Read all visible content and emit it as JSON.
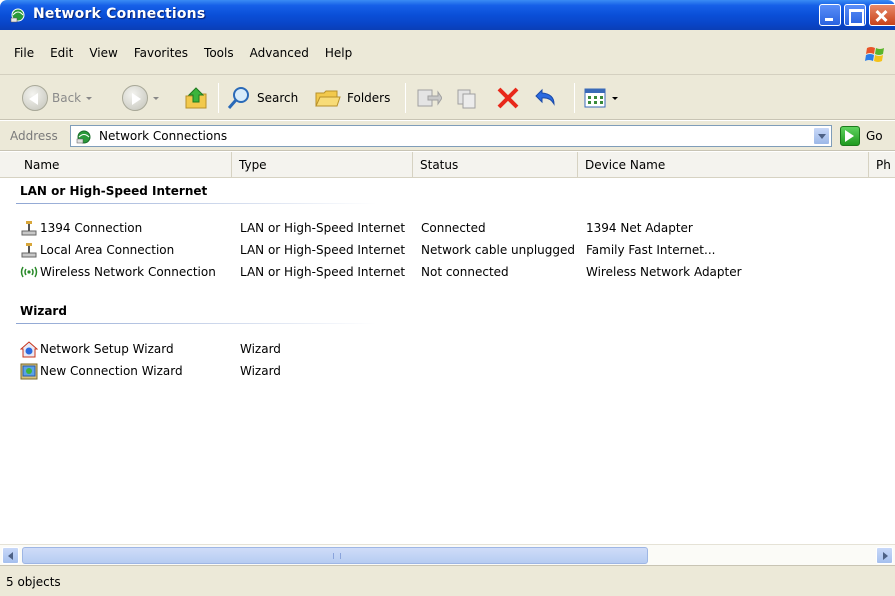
{
  "window": {
    "title": "Network Connections"
  },
  "menu": [
    "File",
    "Edit",
    "View",
    "Favorites",
    "Tools",
    "Advanced",
    "Help"
  ],
  "toolbar": {
    "back_label": "Back",
    "search_label": "Search",
    "folders_label": "Folders"
  },
  "address": {
    "label": "Address",
    "value": "Network Connections",
    "go_label": "Go"
  },
  "columns": [
    "Name",
    "Type",
    "Status",
    "Device Name",
    "Ph"
  ],
  "groups": [
    {
      "title": "LAN or High-Speed Internet",
      "items": [
        {
          "icon": "lan-connection-icon",
          "name": "1394 Connection",
          "type": "LAN or High-Speed Internet",
          "status": "Connected",
          "device": "1394 Net Adapter"
        },
        {
          "icon": "lan-connection-icon",
          "name": "Local Area Connection",
          "type": "LAN or High-Speed Internet",
          "status": "Network cable unplugged",
          "device": "Family Fast Internet..."
        },
        {
          "icon": "wireless-connection-icon",
          "name": "Wireless Network Connection",
          "type": "LAN or High-Speed Internet",
          "status": "Not connected",
          "device": "Wireless Network Adapter"
        }
      ]
    },
    {
      "title": "Wizard",
      "items": [
        {
          "icon": "network-setup-wizard-icon",
          "name": "Network Setup Wizard",
          "type": "Wizard"
        },
        {
          "icon": "new-connection-wizard-icon",
          "name": "New Connection Wizard",
          "type": "Wizard"
        }
      ]
    }
  ],
  "status_bar": {
    "text": "5 objects"
  },
  "colors": {
    "titlebar": "#0a4fd8",
    "chrome": "#ece9d8",
    "group_line": "#8fa6d3"
  }
}
